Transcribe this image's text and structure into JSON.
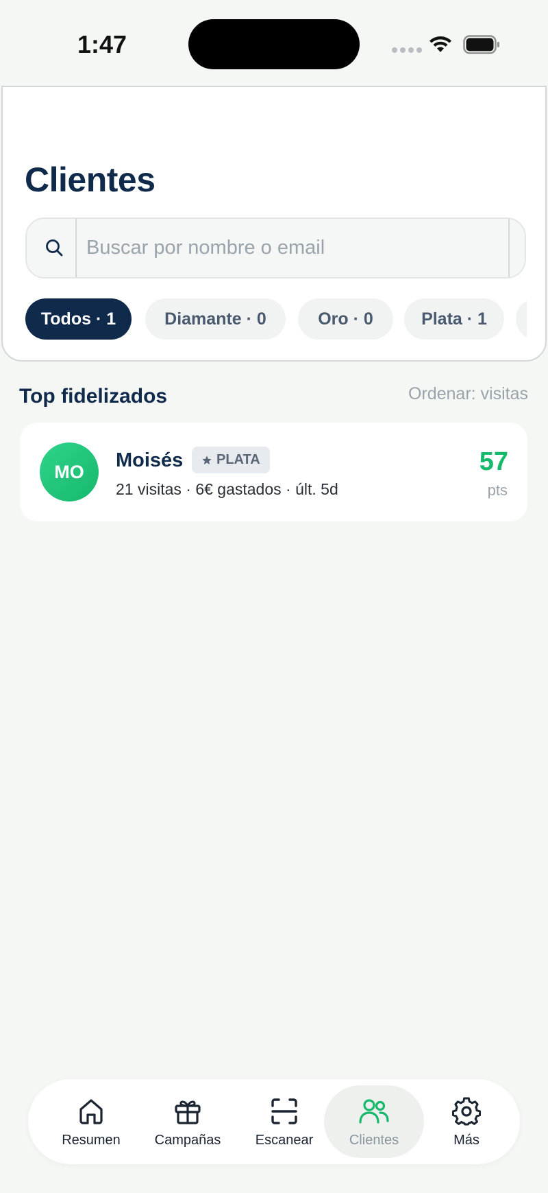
{
  "status_bar": {
    "time": "1:47"
  },
  "header": {
    "title": "Clientes",
    "search": {
      "placeholder": "Buscar por nombre o email",
      "value": ""
    },
    "filters": [
      {
        "label": "Todos · 1",
        "active": true
      },
      {
        "label": "Diamante · 0",
        "active": false
      },
      {
        "label": "Oro · 0",
        "active": false
      },
      {
        "label": "Plata · 1",
        "active": false
      }
    ]
  },
  "section": {
    "title": "Top fidelizados",
    "sort_label": "Ordenar: visitas"
  },
  "clients": [
    {
      "initials": "MO",
      "name": "Moisés",
      "tier": "PLATA",
      "tier_icon": "star-icon",
      "meta": "21 visitas · 6€ gastados · últ. 5d",
      "points": "57",
      "points_unit": "pts"
    }
  ],
  "tab_bar": {
    "items": [
      {
        "label": "Resumen",
        "icon": "home-icon",
        "active": false
      },
      {
        "label": "Campañas",
        "icon": "gift-icon",
        "active": false
      },
      {
        "label": "Escanear",
        "icon": "scan-icon",
        "active": false
      },
      {
        "label": "Clientes",
        "icon": "users-icon",
        "active": true
      },
      {
        "label": "Más",
        "icon": "gear-icon",
        "active": false
      }
    ]
  },
  "colors": {
    "primary": "#0f2a4a",
    "accent_green": "#16b86c",
    "background": "#f5f7f5"
  }
}
